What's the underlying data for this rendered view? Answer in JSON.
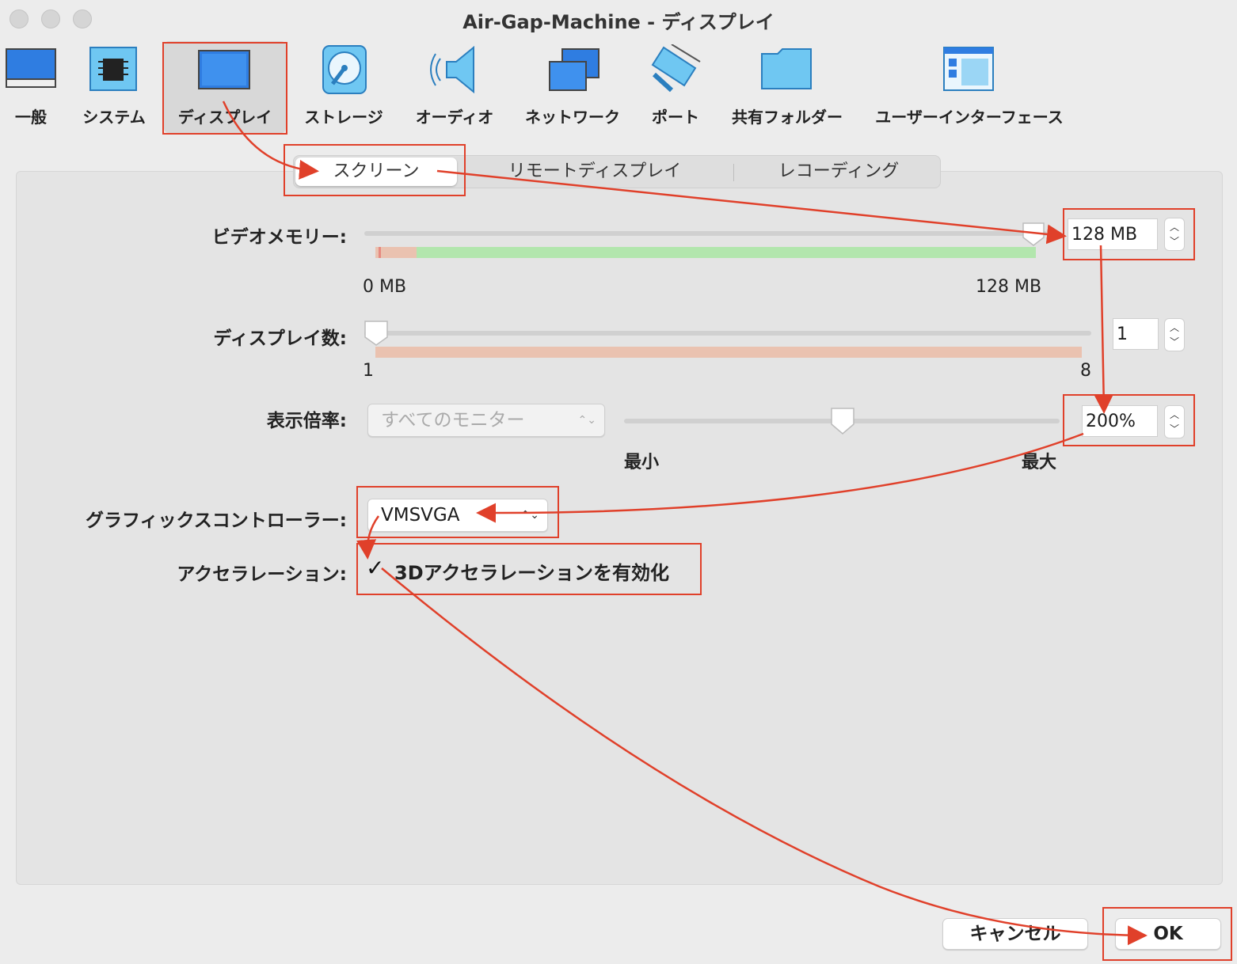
{
  "window": {
    "title": "Air-Gap-Machine - ディスプレイ"
  },
  "toolbar": {
    "items": [
      {
        "label": "一般",
        "icon": "general-monitor-icon"
      },
      {
        "label": "システム",
        "icon": "chip-icon"
      },
      {
        "label": "ディスプレイ",
        "icon": "display-icon"
      },
      {
        "label": "ストレージ",
        "icon": "disk-icon"
      },
      {
        "label": "オーディオ",
        "icon": "speaker-icon"
      },
      {
        "label": "ネットワーク",
        "icon": "network-icon"
      },
      {
        "label": "ポート",
        "icon": "port-icon"
      },
      {
        "label": "共有フォルダー",
        "icon": "folder-icon"
      },
      {
        "label": "ユーザーインターフェース",
        "icon": "ui-window-icon"
      }
    ],
    "selected_index": 2
  },
  "tabs": {
    "items": [
      "スクリーン",
      "リモートディスプレイ",
      "レコーディング"
    ],
    "active_index": 0
  },
  "video_memory": {
    "label": "ビデオメモリー:",
    "value": "128 MB",
    "min_label": "0 MB",
    "max_label": "128 MB",
    "level_fraction": 1.0
  },
  "display_count": {
    "label": "ディスプレイ数:",
    "value": "1",
    "min_label": "1",
    "max_label": "8",
    "level_fraction": 0.0
  },
  "scale": {
    "label": "表示倍率:",
    "monitor_select": "すべてのモニター",
    "value": "200%",
    "min_label": "最小",
    "max_label": "最大",
    "level_fraction": 0.5
  },
  "graphics_controller": {
    "label": "グラフィックスコントローラー:",
    "value": "VMSVGA"
  },
  "acceleration": {
    "label": "アクセラレーション:",
    "checkbox_label": "3Dアクセラレーションを有効化",
    "checked": true
  },
  "buttons": {
    "cancel": "キャンセル",
    "ok": "OK"
  },
  "colors": {
    "annotation": "#e0402a",
    "accent": "#3b8ee8",
    "good_range": "#b2e6ad",
    "warn_range": "#eac2b0"
  }
}
